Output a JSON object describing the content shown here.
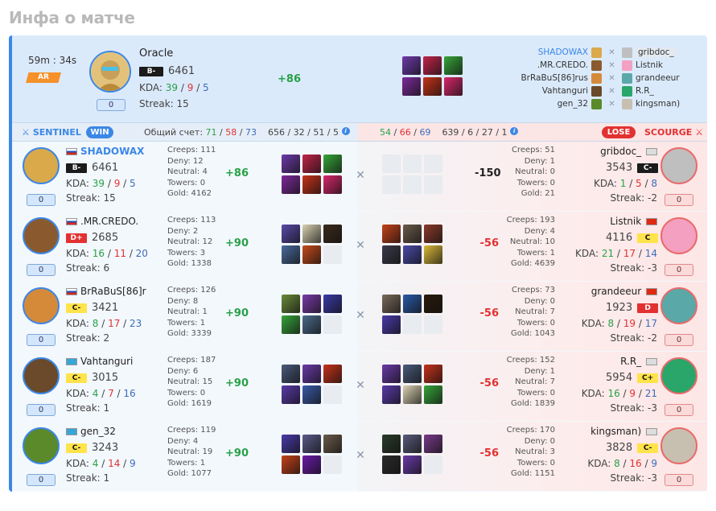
{
  "page_title": "Инфа о матче",
  "match": {
    "duration": "59m : 34s",
    "mode": "AR"
  },
  "featured": {
    "nick": "Oracle",
    "rank": "B-",
    "mmr": "6461",
    "kda_label": "KDA:",
    "k": "39",
    "d": "9",
    "a": "5",
    "streak": "Streak: 15",
    "delta": "+86",
    "counter": "0",
    "items": [
      "#6d3aa8",
      "#c1244a",
      "#36a43a",
      "#7d2a9a",
      "#c5321a",
      "#d6276a"
    ]
  },
  "lineup": [
    {
      "left": "SHADOWAX",
      "right": "gribdoc_",
      "lc": "#d9a94a",
      "rc": "#bfbfbf"
    },
    {
      "left": ".MR.CREDO.",
      "right": "Listnik",
      "lc": "#8a5a2e",
      "rc": "#f4a0c0"
    },
    {
      "left": "BrRaBuS[86]rus",
      "right": "grandeeur",
      "lc": "#d58a3a",
      "rc": "#5aa8a8"
    },
    {
      "left": "Vahtanguri",
      "right": "R.R_",
      "lc": "#6a4a2a",
      "rc": "#2aa66a"
    },
    {
      "left": "gen_32",
      "right": "kingsman)",
      "lc": "#5a8a2a",
      "rc": "#c7c0b0"
    }
  ],
  "scoreboard": {
    "sentinel": "SENTINEL",
    "win": "WIN",
    "total_label": "Общий счет:",
    "s_k": "71",
    "s_d": "58",
    "s_a": "73",
    "s_sep": "/",
    "s_stats": "656 / 32 / 51 / 5",
    "sc_k": "54",
    "sc_d": "66",
    "sc_a": "69",
    "sc_stats": "639 / 6 / 27 / 1",
    "lose": "LOSE",
    "scourge": "SCOURGE"
  },
  "rows": [
    {
      "l": {
        "nick": "SHADOWAX",
        "rank": "B-",
        "rankc": "",
        "mmr": "6461",
        "k": "39",
        "d": "9",
        "a": "5",
        "streak": "Streak: 15",
        "counter": "0",
        "flag": "flagru",
        "hero": "#d9a94a",
        "creeps": "Creeps: 111",
        "deny": "Deny: 12",
        "neutral": "Neutral: 4",
        "towers": "Towers: 0",
        "gold": "Gold: 4162",
        "delta": "+86",
        "items": [
          "#6d3aa8",
          "#c1244a",
          "#36a43a",
          "#7d2a9a",
          "#c5321a",
          "#d6276a"
        ]
      },
      "r": {
        "nick": "gribdoc_",
        "rank": "C-",
        "rankc": "",
        "mmr": "3543",
        "k": "1",
        "d": "5",
        "a": "8",
        "streak": "Streak: -2",
        "counter": "0",
        "flag": "flaggy",
        "hero": "#bfbfbf",
        "creeps": "Creeps: 51",
        "deny": "Deny: 1",
        "neutral": "Neutral: 0",
        "towers": "Towers: 0",
        "gold": "Gold: 21",
        "delta": "-150",
        "items": [
          "",
          "",
          "",
          "",
          "",
          ""
        ]
      }
    },
    {
      "l": {
        "nick": ".MR.CREDO.",
        "rank": "D+",
        "rankc": "r",
        "mmr": "2685",
        "k": "16",
        "d": "11",
        "a": "20",
        "streak": "Streak: 6",
        "counter": "0",
        "flag": "flagru",
        "hero": "#8a5a2e",
        "creeps": "Creeps: 113",
        "deny": "Deny: 2",
        "neutral": "Neutral: 12",
        "towers": "Towers: 3",
        "gold": "Gold: 1338",
        "delta": "+90",
        "items": [
          "#5a4aa8",
          "#d8d0b0",
          "#3a2a1a",
          "#4a6a9a",
          "#c54a1a",
          ""
        ]
      },
      "r": {
        "nick": "Listnik",
        "rank": "C",
        "rankc": "y",
        "mmr": "4116",
        "k": "21",
        "d": "17",
        "a": "14",
        "streak": "Streak: -3",
        "counter": "0",
        "flag": "flagcn",
        "hero": "#f4a0c0",
        "creeps": "Creeps: 193",
        "deny": "Deny: 4",
        "neutral": "Neutral: 10",
        "towers": "Towers: 1",
        "gold": "Gold: 4639",
        "delta": "-56",
        "items": [
          "#c5421a",
          "#6a5a4a",
          "#8a3a2a",
          "#3a3a4a",
          "#4a4aa8",
          "#d8b83a"
        ]
      }
    },
    {
      "l": {
        "nick": "BrRaBuS[86]r",
        "rank": "C-",
        "rankc": "y",
        "mmr": "3421",
        "k": "8",
        "d": "17",
        "a": "23",
        "streak": "Streak: 2",
        "counter": "0",
        "flag": "flagru",
        "hero": "#d58a3a",
        "creeps": "Creeps: 126",
        "deny": "Deny: 8",
        "neutral": "Neutral: 1",
        "towers": "Towers: 1",
        "gold": "Gold: 3339",
        "delta": "+90",
        "items": [
          "#6a8a3a",
          "#7a3aa8",
          "#3a3aa8",
          "#36a43a",
          "#4a6a8a",
          ""
        ]
      },
      "r": {
        "nick": "grandeeur",
        "rank": "D",
        "rankc": "r",
        "mmr": "1923",
        "k": "8",
        "d": "19",
        "a": "17",
        "streak": "Streak: -2",
        "counter": "0",
        "flag": "flagcn",
        "hero": "#5aa8a8",
        "creeps": "Creeps: 73",
        "deny": "Deny: 0",
        "neutral": "Neutral: 7",
        "towers": "Towers: 0",
        "gold": "Gold: 1043",
        "delta": "-56",
        "items": [
          "#7a6a5a",
          "#2a5aa8",
          "#2a1a0a",
          "#4a3aa8",
          "",
          ""
        ]
      }
    },
    {
      "l": {
        "nick": "Vahtanguri",
        "rank": "C-",
        "rankc": "y",
        "mmr": "3015",
        "k": "4",
        "d": "7",
        "a": "16",
        "streak": "Streak: 1",
        "counter": "0",
        "flag": "flagkz",
        "hero": "#6a4a2a",
        "creeps": "Creeps: 187",
        "deny": "Deny: 6",
        "neutral": "Neutral: 15",
        "towers": "Towers: 0",
        "gold": "Gold: 1619",
        "delta": "+90",
        "items": [
          "#4a5a7a",
          "#6a3aa8",
          "#c5321a",
          "#5a3aa8",
          "#3a5aa8",
          ""
        ]
      },
      "r": {
        "nick": "R.R_",
        "rank": "C+",
        "rankc": "y",
        "mmr": "5954",
        "k": "16",
        "d": "9",
        "a": "21",
        "streak": "Streak: -3",
        "counter": "0",
        "flag": "flaggy",
        "hero": "#2aa66a",
        "creeps": "Creeps: 152",
        "deny": "Deny: 1",
        "neutral": "Neutral: 7",
        "towers": "Towers: 0",
        "gold": "Gold: 1839",
        "delta": "-56",
        "items": [
          "#6a3aa8",
          "#4a5a7a",
          "#c5321a",
          "#5a3aa8",
          "#d8d0b0",
          "#36a43a"
        ]
      }
    },
    {
      "l": {
        "nick": "gen_32",
        "rank": "C-",
        "rankc": "y",
        "mmr": "3243",
        "k": "4",
        "d": "14",
        "a": "9",
        "streak": "Streak: 1",
        "counter": "0",
        "flag": "flagkz",
        "hero": "#5a8a2a",
        "creeps": "Creeps: 119",
        "deny": "Deny: 4",
        "neutral": "Neutral: 19",
        "towers": "Towers: 1",
        "gold": "Gold: 1077",
        "delta": "+90",
        "items": [
          "#4a3aa8",
          "#5a5a8a",
          "#6a5a4a",
          "#c5421a",
          "#6a1aa8",
          ""
        ]
      },
      "r": {
        "nick": "kingsman)",
        "rank": "C-",
        "rankc": "y",
        "mmr": "3828",
        "k": "8",
        "d": "16",
        "a": "9",
        "streak": "Streak: -3",
        "counter": "0",
        "flag": "flaggy",
        "hero": "#c7c0b0",
        "creeps": "Creeps: 170",
        "deny": "Deny: 0",
        "neutral": "Neutral: 3",
        "towers": "Towers: 0",
        "gold": "Gold: 1151",
        "delta": "-56",
        "items": [
          "#2a3a2a",
          "#5a5a7a",
          "#7a3a8a",
          "#2a2a2a",
          "#6a3aa8",
          ""
        ]
      }
    }
  ]
}
